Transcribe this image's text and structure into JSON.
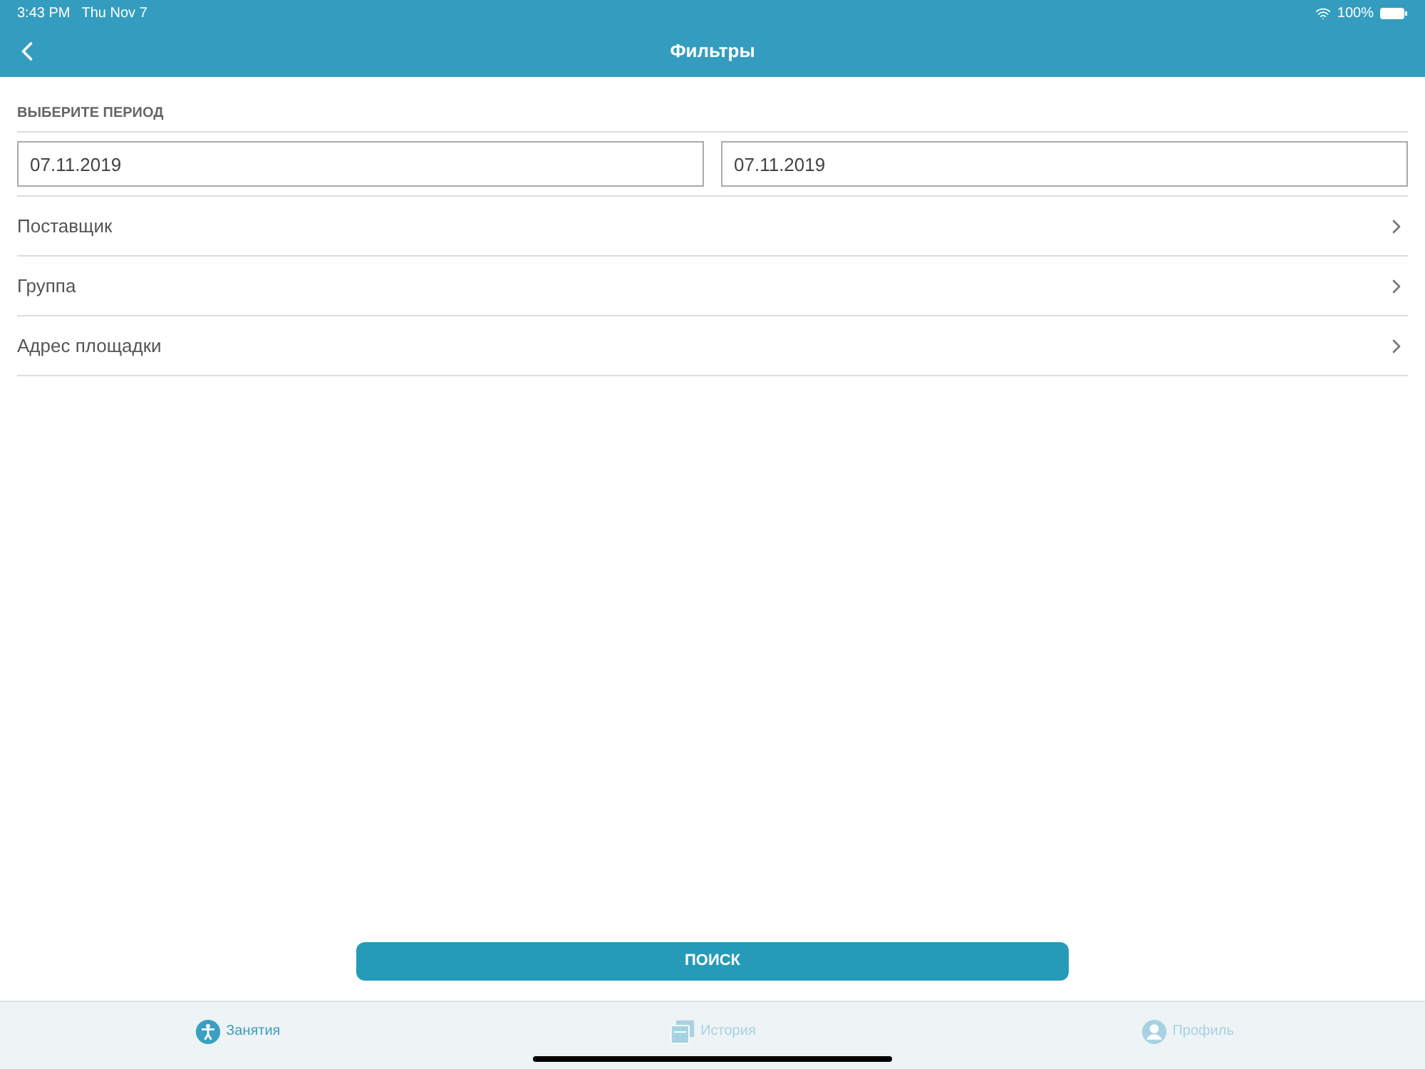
{
  "status_bar": {
    "time": "3:43 PM",
    "date": "Thu Nov 7",
    "battery": "100%"
  },
  "nav": {
    "title": "Фильтры"
  },
  "period": {
    "label": "ВЫБЕРИТЕ ПЕРИОД",
    "from": "07.11.2019",
    "to": "07.11.2019"
  },
  "filters": [
    {
      "label": "Поставщик"
    },
    {
      "label": "Группа"
    },
    {
      "label": "Адрес площадки"
    }
  ],
  "search_button": "ПОИСК",
  "tabs": [
    {
      "kind": "person",
      "label": "Занятия",
      "selected": true
    },
    {
      "kind": "history",
      "label": "История",
      "selected": false
    },
    {
      "kind": "profile",
      "label": "Профиль",
      "selected": false
    }
  ]
}
